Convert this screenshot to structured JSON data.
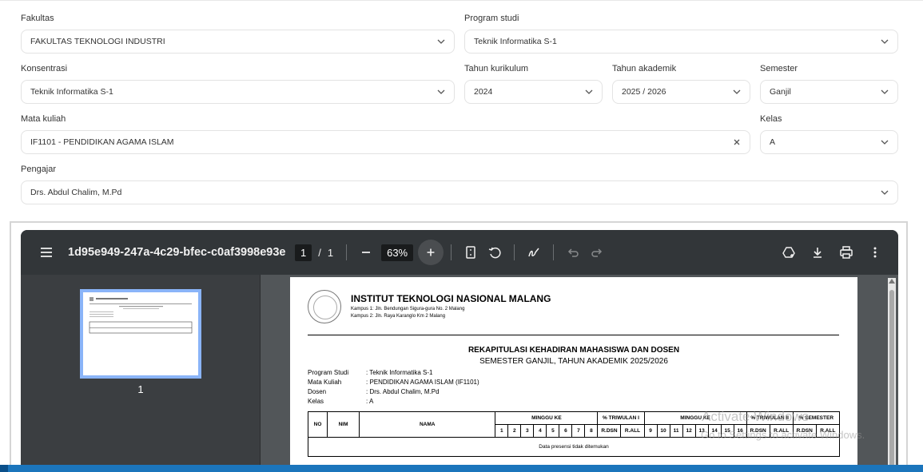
{
  "form": {
    "fakultas": {
      "label": "Fakultas",
      "value": "FAKULTAS TEKNOLOGI INDUSTRI"
    },
    "program_studi": {
      "label": "Program studi",
      "value": "Teknik Informatika S-1"
    },
    "konsentrasi": {
      "label": "Konsentrasi",
      "value": "Teknik Informatika S-1"
    },
    "tahun_kurikulum": {
      "label": "Tahun kurikulum",
      "value": "2024"
    },
    "tahun_akademik": {
      "label": "Tahun akademik",
      "value": "2025 / 2026"
    },
    "semester": {
      "label": "Semester",
      "value": "Ganjil"
    },
    "mata_kuliah": {
      "label": "Mata kuliah",
      "value": "IF1101 - PENDIDIKAN AGAMA ISLAM"
    },
    "kelas": {
      "label": "Kelas",
      "value": "A"
    },
    "pengajar": {
      "label": "Pengajar",
      "value": "Drs. Abdul Chalim, M.Pd"
    }
  },
  "viewer": {
    "file_title": "1d95e949-247a-4c29-bfec-c0af3998e93e",
    "current_page": "1",
    "page_separator": "/",
    "total_pages": "1",
    "zoom": "63%",
    "thumbnail_page": "1",
    "icons": [
      "menu-icon",
      "zoom-out-icon",
      "zoom-in-icon",
      "fit-page-icon",
      "rotate-icon",
      "annotate-icon",
      "undo-icon",
      "redo-icon",
      "save-drive-icon",
      "download-icon",
      "print-icon",
      "more-icon"
    ]
  },
  "document": {
    "institution": "INSTITUT TEKNOLOGI NASIONAL MALANG",
    "campus1": "Kampus 1: Jln. Bendungan Sigura-gura No. 2 Malang",
    "campus2": "Kampus 2: Jln. Raya Karanglo Km 2 Malang",
    "title": "REKAPITULASI KEHADIRAN MAHASISWA DAN DOSEN",
    "subtitle": "SEMESTER GANJIL, TAHUN AKADEMIK 2025/2026",
    "info": [
      {
        "key": "Program Studi",
        "value": ": Teknik Informatika S-1"
      },
      {
        "key": "Mata Kuliah",
        "value": ": PENDIDIKAN AGAMA ISLAM  (IF1101)"
      },
      {
        "key": "Dosen",
        "value": ": Drs. Abdul Chalim, M.Pd"
      },
      {
        "key": "Kelas",
        "value": ": A"
      }
    ],
    "table": {
      "no": "NO",
      "nim": "NIM",
      "nama": "NAMA",
      "minggu_ke_1": "MINGGU KE",
      "triwulan1": "% TRIWULAN I",
      "minggu_ke_2": "MINGGU KE",
      "triwulan2": "% TRIWULAN II",
      "semester": "% SEMESTER",
      "weeks1": [
        "1",
        "2",
        "3",
        "4",
        "5",
        "6",
        "7",
        "8"
      ],
      "weeks2": [
        "9",
        "10",
        "11",
        "12",
        "13",
        "14",
        "15",
        "16"
      ],
      "rdsn": "R.DSN",
      "rall": "R.ALL",
      "empty_message": "Data presensi tidak ditemukan"
    }
  },
  "watermark": {
    "line1": "Activate Windows",
    "line2": "Go to Settings to activate Windows."
  }
}
